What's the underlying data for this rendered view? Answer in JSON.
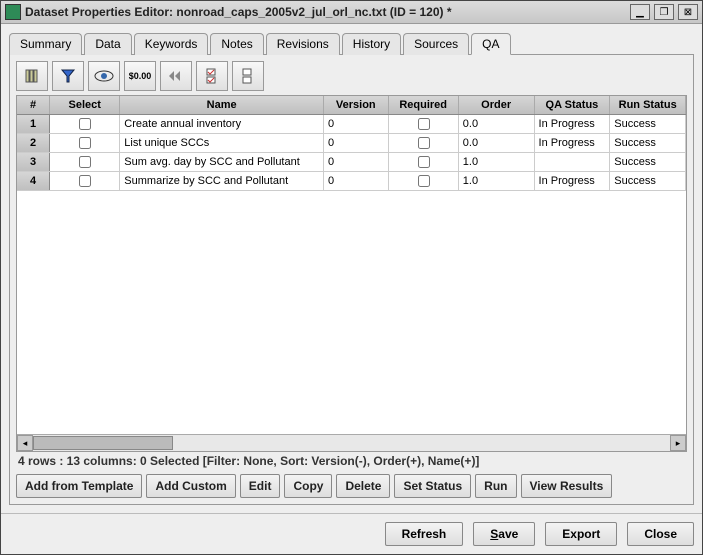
{
  "window": {
    "title": "Dataset Properties Editor: nonroad_caps_2005v2_jul_orl_nc.txt (ID = 120) *"
  },
  "tabs": [
    {
      "label": "Summary"
    },
    {
      "label": "Data"
    },
    {
      "label": "Keywords"
    },
    {
      "label": "Notes"
    },
    {
      "label": "Revisions"
    },
    {
      "label": "History"
    },
    {
      "label": "Sources"
    },
    {
      "label": "QA"
    }
  ],
  "columns": {
    "num": "#",
    "select": "Select",
    "name": "Name",
    "version": "Version",
    "required": "Required",
    "order": "Order",
    "qa_status": "QA Status",
    "run_status": "Run Status"
  },
  "rows": [
    {
      "num": "1",
      "select": false,
      "name": "Create annual inventory",
      "version": "0",
      "required": false,
      "order": "0.0",
      "qa_status": "In Progress",
      "run_status": "Success"
    },
    {
      "num": "2",
      "select": false,
      "name": "List unique SCCs",
      "version": "0",
      "required": false,
      "order": "0.0",
      "qa_status": "In Progress",
      "run_status": "Success"
    },
    {
      "num": "3",
      "select": false,
      "name": "Sum avg. day by SCC and Pollutant",
      "version": "0",
      "required": false,
      "order": "1.0",
      "qa_status": "",
      "run_status": "Success"
    },
    {
      "num": "4",
      "select": false,
      "name": "Summarize by SCC and Pollutant",
      "version": "0",
      "required": false,
      "order": "1.0",
      "qa_status": "In Progress",
      "run_status": "Success"
    }
  ],
  "status_text": "4 rows : 13 columns: 0 Selected [Filter: None, Sort: Version(-), Order(+), Name(+)]",
  "action_buttons": {
    "add_template": "Add from Template",
    "add_custom": "Add Custom",
    "edit": "Edit",
    "copy": "Copy",
    "delete": "Delete",
    "set_status": "Set Status",
    "run": "Run",
    "view_results": "View Results"
  },
  "bottom_buttons": {
    "refresh": "Refresh",
    "save_pre": "S",
    "save_post": "ave",
    "export": "Export",
    "close": "Close"
  },
  "toolbar_icons": {
    "cols": "columns-icon",
    "filter": "filter-icon",
    "view": "view-icon",
    "format": "format-icon",
    "first": "first-page-icon",
    "select_all": "select-all-icon",
    "deselect_all": "deselect-all-icon"
  }
}
